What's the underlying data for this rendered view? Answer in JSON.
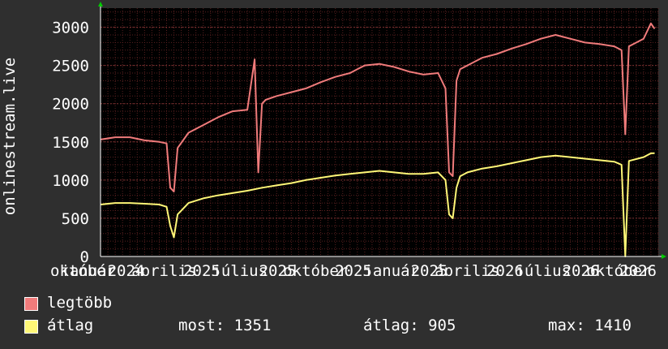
{
  "chart_data": {
    "type": "line",
    "ylabel": "onlinestream.live",
    "ylim": [
      0,
      3250
    ],
    "yticks": [
      0,
      500,
      1000,
      1500,
      2000,
      2500,
      3000
    ],
    "grid": true,
    "x_tick_labels": [
      "október",
      "január",
      "2024",
      "április",
      "2025",
      "július",
      "2025",
      "október",
      "2025",
      "január",
      "2025",
      "április",
      "2026",
      "július",
      "2026",
      "október",
      "2026"
    ],
    "x_range_weeks": [
      0,
      152
    ],
    "series": [
      {
        "name": "legtöbb",
        "color": "#f07b7b",
        "x_weeks": [
          0,
          4,
          8,
          12,
          16,
          18,
          19,
          20,
          21,
          24,
          28,
          32,
          36,
          40,
          42,
          43,
          44,
          45,
          48,
          52,
          56,
          60,
          64,
          68,
          70,
          72,
          76,
          80,
          84,
          88,
          92,
          94,
          95,
          96,
          97,
          98,
          100,
          104,
          108,
          112,
          116,
          120,
          124,
          128,
          132,
          136,
          140,
          142,
          143,
          144,
          148,
          150,
          151
        ],
        "values": [
          1530,
          1560,
          1560,
          1520,
          1500,
          1480,
          900,
          850,
          1420,
          1620,
          1720,
          1820,
          1900,
          1920,
          2580,
          1100,
          2000,
          2050,
          2100,
          2150,
          2200,
          2280,
          2350,
          2400,
          2450,
          2500,
          2520,
          2480,
          2420,
          2380,
          2400,
          2200,
          1100,
          1050,
          2300,
          2450,
          2500,
          2600,
          2650,
          2720,
          2780,
          2850,
          2900,
          2850,
          2800,
          2780,
          2750,
          2700,
          1600,
          2750,
          2850,
          3050,
          2980
        ]
      },
      {
        "name": "átlag",
        "color": "#fff777",
        "x_weeks": [
          0,
          4,
          8,
          12,
          16,
          18,
          19,
          20,
          21,
          24,
          28,
          32,
          36,
          40,
          44,
          48,
          52,
          56,
          60,
          64,
          68,
          72,
          76,
          80,
          84,
          88,
          92,
          94,
          95,
          96,
          97,
          98,
          100,
          104,
          108,
          112,
          116,
          120,
          124,
          128,
          132,
          136,
          140,
          142,
          143,
          144,
          148,
          150,
          151
        ],
        "values": [
          680,
          700,
          700,
          690,
          680,
          650,
          400,
          250,
          550,
          700,
          760,
          800,
          830,
          860,
          900,
          930,
          960,
          1000,
          1030,
          1060,
          1080,
          1100,
          1120,
          1100,
          1080,
          1080,
          1100,
          1000,
          550,
          500,
          900,
          1050,
          1100,
          1150,
          1180,
          1220,
          1260,
          1300,
          1320,
          1300,
          1280,
          1260,
          1240,
          1200,
          0,
          1250,
          1300,
          1350,
          1351
        ]
      }
    ]
  },
  "legend": {
    "max_label": "legtöbb",
    "avg_label": "átlag"
  },
  "stats": {
    "current": "most: 1351",
    "average": "átlag: 905",
    "maximum": "max: 1410"
  }
}
